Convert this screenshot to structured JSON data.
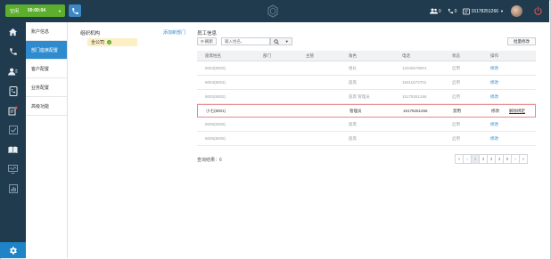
{
  "topbar": {
    "status_label": "空闲",
    "timer": "00:00:04",
    "counter_a": "0",
    "counter_b": "0",
    "phone_number": "15178251266"
  },
  "sidebar": {
    "icons": [
      "home-icon",
      "phone-icon",
      "contacts-icon",
      "call-log-icon",
      "notes-icon",
      "check-icon",
      "book-icon",
      "monitor-icon",
      "report-icon"
    ],
    "settings_icon": "gear-icon"
  },
  "subnav": {
    "items": [
      "账户信息",
      "部门座席配置",
      "客户配置",
      "业务配置",
      "高级功能"
    ],
    "active_index": 1
  },
  "org": {
    "title": "组织机构",
    "link": "添加新部门",
    "root": "全公司"
  },
  "employees": {
    "title": "员工信息",
    "refresh_label": "刷新",
    "search_placeholder": "输入姓名、",
    "batch_label": "批量修改",
    "headers": [
      "座席姓名",
      "部门",
      "主管",
      "角色",
      "电话",
      "状态",
      "操作"
    ],
    "rows": [
      {
        "name": "8003(8003)",
        "dept": "",
        "supervisor": "",
        "role": "组长",
        "phone": "12345678901",
        "status": "启用",
        "action": "修改",
        "extra": "",
        "highlight": false
      },
      {
        "name": "8004(8004)",
        "dept": "",
        "supervisor": "",
        "role": "座席",
        "phone": "15011573701",
        "status": "启用",
        "action": "修改",
        "extra": "",
        "highlight": false
      },
      {
        "name": "8002(8002)",
        "dept": "",
        "supervisor": "",
        "role": "座席 管理员",
        "phone": "15178251266",
        "status": "启用",
        "action": "修改",
        "extra": "",
        "highlight": false
      },
      {
        "name": "小七(8001)",
        "dept": "",
        "supervisor": "",
        "role": "管理员",
        "phone": "15178251266",
        "status": "禁用",
        "action": "修改",
        "extra": "解除绑定",
        "highlight": true
      },
      {
        "name": "8006(8006)",
        "dept": "",
        "supervisor": "",
        "role": "座席",
        "phone": "",
        "status": "启用",
        "action": "修改",
        "extra": "",
        "highlight": false
      },
      {
        "name": "8005(8005)",
        "dept": "",
        "supervisor": "",
        "role": "座席",
        "phone": "",
        "status": "启用",
        "action": "修改",
        "extra": "",
        "highlight": false
      }
    ],
    "result_label": "查询结果：6"
  },
  "pagination": {
    "prev": "«",
    "pages": [
      "‹",
      "1",
      "2",
      "3",
      "4",
      "5",
      "›"
    ],
    "next": "»"
  },
  "colors": {
    "topbar": "#203a4e",
    "status_green": "#5cae2d",
    "accent_blue": "#2e8bcd",
    "highlight_border": "#e58a8a",
    "disabled_red": "#d9534f"
  }
}
